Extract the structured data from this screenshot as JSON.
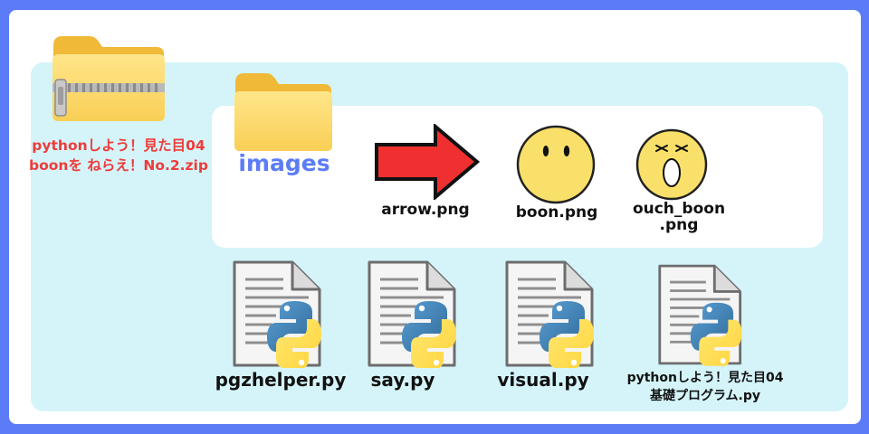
{
  "archive": {
    "icon": "zip-folder-icon",
    "name_line1": "pythonしよう！見た目04",
    "name_line2": "boonを ねらえ！No.2.zip"
  },
  "images_folder": {
    "icon": "folder-icon",
    "name": "images",
    "files": [
      {
        "icon": "red-arrow-icon",
        "name": "arrow.png"
      },
      {
        "icon": "boon-face-icon",
        "name": "boon.png"
      },
      {
        "icon": "ouch-boon-face-icon",
        "name_line1": "ouch_boon",
        "name_line2": ".png"
      }
    ]
  },
  "python_files": [
    {
      "icon": "python-file-icon",
      "name": "pgzhelper.py"
    },
    {
      "icon": "python-file-icon",
      "name": "say.py"
    },
    {
      "icon": "python-file-icon",
      "name": "visual.py"
    },
    {
      "icon": "python-file-icon",
      "name_line1": "pythonしよう！見た目04",
      "name_line2": "基礎プログラム.py"
    }
  ],
  "colors": {
    "frame": "#5b7cf6",
    "panel": "#d4f4f9",
    "zip_label": "#ef3b3b",
    "folder_label": "#5b7cf6",
    "arrow": "#f03030",
    "face": "#f9e06b"
  }
}
